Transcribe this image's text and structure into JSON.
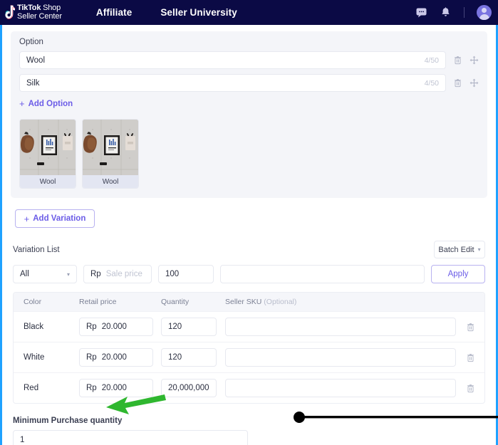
{
  "topbar": {
    "brand_line1_bold": "TikTok",
    "brand_line1_rest": " Shop",
    "brand_line2": "Seller Center",
    "nav": [
      {
        "label": "Affiliate"
      },
      {
        "label": "Seller University"
      }
    ],
    "icons": {
      "message": "message-icon",
      "bell": "bell-icon",
      "avatar": "user-avatar"
    },
    "bg_color": "#0b0a45"
  },
  "option_section": {
    "label": "Option",
    "rows": [
      {
        "value": "Wool",
        "counter": "4/50"
      },
      {
        "value": "Silk",
        "counter": "4/50"
      }
    ],
    "add_option_label": "Add Option",
    "add_plus": "+"
  },
  "thumbnails": [
    {
      "caption": "Wool"
    },
    {
      "caption": "Wool"
    }
  ],
  "add_variation": {
    "label": "Add Variation",
    "plus": "+"
  },
  "variation_list": {
    "title": "Variation List",
    "batch_edit_label": "Batch Edit",
    "chevron": "∨",
    "controls": {
      "select_value": "All",
      "currency": "Rp",
      "price_placeholder": "Sale price",
      "price_value": "",
      "quantity_value": "100",
      "sku_value": "",
      "apply_label": "Apply"
    },
    "columns": {
      "color": "Color",
      "retail_price": "Retail price",
      "quantity": "Quantity",
      "seller_sku": "Seller SKU",
      "seller_sku_optional": "(Optional)"
    },
    "rows": [
      {
        "color": "Black",
        "currency": "Rp",
        "price": "20.000",
        "quantity": "120",
        "sku": ""
      },
      {
        "color": "White",
        "currency": "Rp",
        "price": "20.000",
        "quantity": "120",
        "sku": ""
      },
      {
        "color": "Red",
        "currency": "Rp",
        "price": "20.000",
        "quantity": "20,000,000",
        "sku": ""
      }
    ]
  },
  "minimum_purchase": {
    "label": "Minimum Purchase quantity",
    "value": "1"
  },
  "annotations": {
    "arrow_color": "#2fb72f",
    "line_color": "#000000"
  },
  "colors": {
    "accent_purple": "#6b5ce7",
    "navy": "#0b0a45",
    "panel_grey": "#f4f5f9",
    "edge_blue": "#1fa2ff"
  }
}
